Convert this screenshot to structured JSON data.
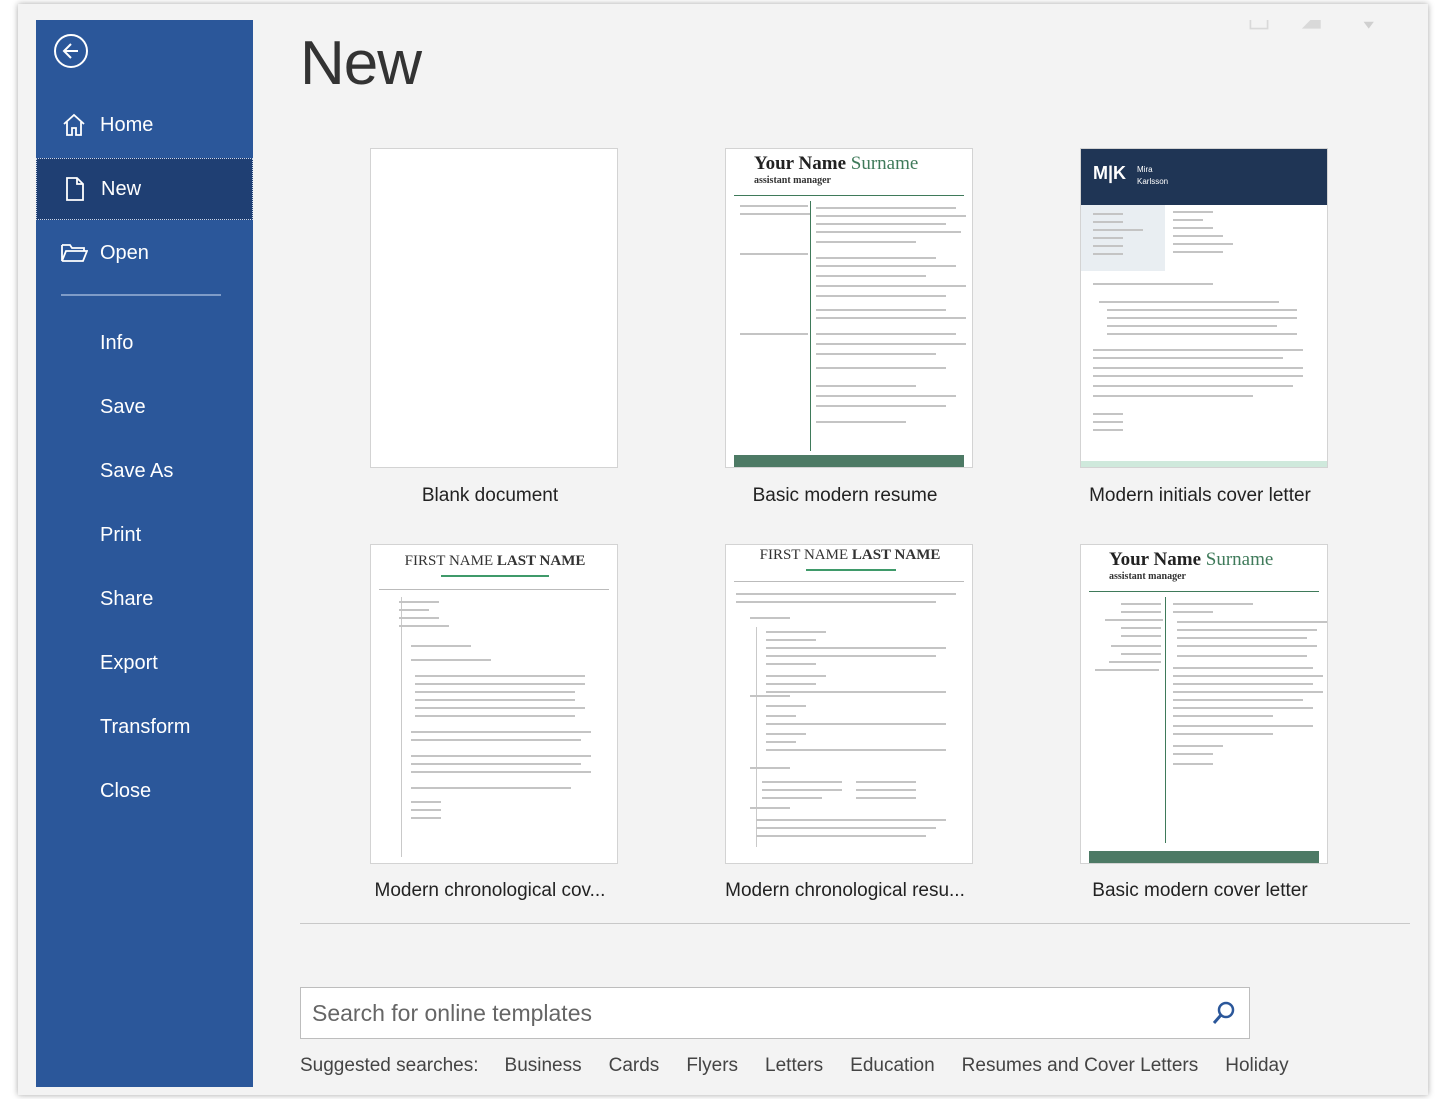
{
  "page": {
    "title": "New"
  },
  "sidebar": {
    "items": [
      {
        "label": "Home",
        "icon": "home-icon"
      },
      {
        "label": "New",
        "icon": "new-document-icon",
        "active": true
      },
      {
        "label": "Open",
        "icon": "open-folder-icon"
      },
      {
        "label": "Info"
      },
      {
        "label": "Save"
      },
      {
        "label": "Save As"
      },
      {
        "label": "Print"
      },
      {
        "label": "Share"
      },
      {
        "label": "Export"
      },
      {
        "label": "Transform"
      },
      {
        "label": "Close"
      }
    ]
  },
  "templates": [
    {
      "label": "Blank document"
    },
    {
      "label": "Basic modern resume",
      "name": "Your Name",
      "surname": "Surname",
      "subtitle": "assistant manager"
    },
    {
      "label": "Modern initials cover letter",
      "initials": "M|K",
      "name1": "Mira",
      "name2": "Karlsson"
    },
    {
      "label": "Modern chronological cov...",
      "heading_first": "FIRST NAME",
      "heading_last": "LAST NAME"
    },
    {
      "label": "Modern chronological resu...",
      "heading_first": "FIRST NAME",
      "heading_last": "LAST NAME"
    },
    {
      "label": "Basic modern cover letter",
      "name": "Your Name",
      "surname": "Surname",
      "subtitle": "assistant manager"
    }
  ],
  "search": {
    "placeholder": "Search for online templates"
  },
  "suggested": {
    "lead": "Suggested searches:",
    "items": [
      "Business",
      "Cards",
      "Flyers",
      "Letters",
      "Education",
      "Resumes and Cover Letters",
      "Holiday"
    ]
  },
  "colors": {
    "sidebar": "#2b579a",
    "active": "#1f3f73",
    "accent_green": "#3f7a5a",
    "navy": "#1f3555"
  }
}
